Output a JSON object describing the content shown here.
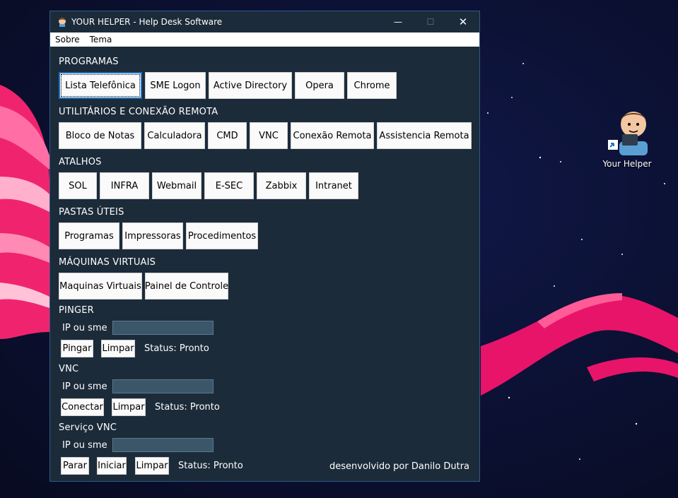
{
  "window": {
    "title": "YOUR HELPER - Help Desk Software",
    "controls": {
      "minimize": "—",
      "maximize": "☐",
      "close": "✕"
    }
  },
  "menu": [
    "Sobre",
    "Tema"
  ],
  "sections": {
    "programas": {
      "title": "PROGRAMAS",
      "buttons": [
        "Lista Telefônica",
        "SME Logon",
        "Active Directory",
        "Opera",
        "Chrome"
      ]
    },
    "utilitarios": {
      "title": "UTILITÁRIOS E CONEXÃO REMOTA",
      "buttons": [
        "Bloco de Notas",
        "Calculadora",
        "CMD",
        "VNC",
        "Conexão Remota",
        "Assistencia Remota"
      ]
    },
    "atalhos": {
      "title": "ATALHOS",
      "buttons": [
        "SOL",
        "INFRA",
        "Webmail",
        "E-SEC",
        "Zabbix",
        "Intranet"
      ]
    },
    "pastas": {
      "title": "PASTAS ÚTEIS",
      "buttons": [
        "Programas",
        "Impressoras",
        "Procedimentos"
      ]
    },
    "maquinas": {
      "title": "MÁQUINAS VIRTUAIS",
      "buttons": [
        "Maquinas Virtuais",
        "Painel de Controle"
      ]
    }
  },
  "pinger": {
    "title": "PINGER",
    "field_label": "IP ou sme",
    "value": "",
    "buttons": [
      "Pingar",
      "Limpar"
    ],
    "status": "Status: Pronto"
  },
  "vnc": {
    "title": "VNC",
    "field_label": "IP ou sme",
    "value": "",
    "buttons": [
      "Conectar",
      "Limpar"
    ],
    "status": "Status: Pronto"
  },
  "servico_vnc": {
    "title": "Serviço VNC",
    "field_label": "IP ou sme",
    "value": "",
    "buttons": [
      "Parar",
      "Iniciar",
      "Limpar"
    ],
    "status": "Status: Pronto"
  },
  "footer": "desenvolvido por Danilo Dutra",
  "desktop": {
    "icon_label": "Your Helper"
  },
  "colors": {
    "window_bg": "#1c2b3a",
    "accent_pink": "#e8146a",
    "desktop_bg": "#0d1030"
  }
}
